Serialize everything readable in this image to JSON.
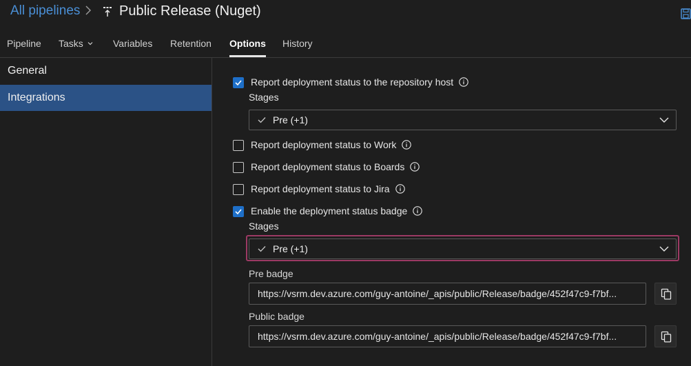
{
  "header": {
    "breadcrumb_root": "All pipelines",
    "breadcrumb_sep": ">",
    "title": "Public Release (Nuget)"
  },
  "tabs": [
    {
      "label": "Pipeline"
    },
    {
      "label": "Tasks"
    },
    {
      "label": "Variables"
    },
    {
      "label": "Retention"
    },
    {
      "label": "Options",
      "active": true
    },
    {
      "label": "History"
    }
  ],
  "sidebar": {
    "items": [
      {
        "label": "General"
      },
      {
        "label": "Integrations",
        "selected": true
      }
    ]
  },
  "options": {
    "report_repo": {
      "label": "Report deployment status to the repository host",
      "checked": true
    },
    "stages_label_1": "Stages",
    "stages_value_1": "Pre (+1)",
    "report_work": {
      "label": "Report deployment status to Work",
      "checked": false
    },
    "report_boards": {
      "label": "Report deployment status to Boards",
      "checked": false
    },
    "report_jira": {
      "label": "Report deployment status to Jira",
      "checked": false
    },
    "badge": {
      "label": "Enable the deployment status badge",
      "checked": true
    },
    "stages_label_2": "Stages",
    "stages_value_2": "Pre (+1)",
    "pre_badge_label": "Pre badge",
    "pre_badge_url": "https://vsrm.dev.azure.com/guy-antoine/_apis/public/Release/badge/452f47c9-f7bf...",
    "public_badge_label": "Public badge",
    "public_badge_url": "https://vsrm.dev.azure.com/guy-antoine/_apis/public/Release/badge/452f47c9-f7bf..."
  },
  "colors": {
    "accent": "#1e6fc8",
    "selected_nav": "#2b5286",
    "focus_ring": "#9c3a64",
    "link": "#4a8fd6"
  }
}
